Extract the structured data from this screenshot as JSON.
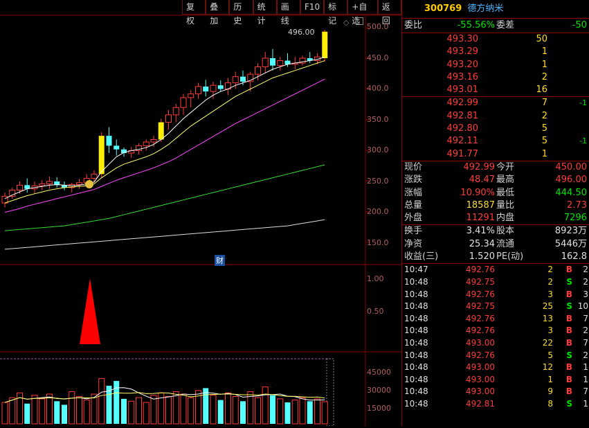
{
  "toolbar": [
    "复权",
    "叠加",
    "历史",
    "统计",
    "画线",
    "F10",
    "标记",
    "+自选",
    "返回"
  ],
  "stock": {
    "code": "300769",
    "name": "德方纳米"
  },
  "price_axis": [
    "500.0",
    "450.0",
    "400.0",
    "350.0",
    "300.0",
    "250.0",
    "200.0",
    "150.0"
  ],
  "hi_label": "496.00",
  "fin_label": "财",
  "ind_axis": [
    "1.00",
    "0.50"
  ],
  "vol_axis": [
    "45000",
    "30000",
    "15000"
  ],
  "weibi": {
    "label1": "委比",
    "value1": "-55.56%",
    "label2": "委差",
    "value2": "-50"
  },
  "sells": [
    {
      "label": "卖五",
      "price": "493.30",
      "vol": "50",
      "chg": ""
    },
    {
      "label": "卖四",
      "price": "493.29",
      "vol": "1",
      "chg": ""
    },
    {
      "label": "卖三",
      "price": "493.20",
      "vol": "1",
      "chg": ""
    },
    {
      "label": "卖二",
      "price": "493.16",
      "vol": "2",
      "chg": ""
    },
    {
      "label": "卖一",
      "price": "493.01",
      "vol": "16",
      "chg": ""
    }
  ],
  "buys": [
    {
      "label": "买一",
      "price": "492.99",
      "vol": "7",
      "chg": "-1"
    },
    {
      "label": "买二",
      "price": "492.81",
      "vol": "2",
      "chg": ""
    },
    {
      "label": "买三",
      "price": "492.80",
      "vol": "5",
      "chg": ""
    },
    {
      "label": "买四",
      "price": "492.11",
      "vol": "5",
      "chg": "-1"
    },
    {
      "label": "买五",
      "price": "491.77",
      "vol": "1",
      "chg": ""
    }
  ],
  "stats": [
    {
      "l1": "现价",
      "v1": "492.99",
      "l2": "今开",
      "v2": "450.00",
      "c1": "red",
      "c2": "red"
    },
    {
      "l1": "涨跌",
      "v1": "48.47",
      "l2": "最高",
      "v2": "496.00",
      "c1": "red",
      "c2": "red"
    },
    {
      "l1": "涨幅",
      "v1": "10.90%",
      "l2": "最低",
      "v2": "444.50",
      "c1": "red",
      "c2": "green"
    },
    {
      "l1": "总量",
      "v1": "18587",
      "l2": "量比",
      "v2": "2.73",
      "c1": "yellow",
      "c2": "red"
    },
    {
      "l1": "外盘",
      "v1": "11291",
      "l2": "内盘",
      "v2": "7296",
      "c1": "red",
      "c2": "green"
    }
  ],
  "stats2": [
    {
      "l1": "换手",
      "v1": "3.41%",
      "l2": "股本",
      "v2": "8923万"
    },
    {
      "l1": "净资",
      "v1": "25.34",
      "l2": "流通",
      "v2": "5446万"
    },
    {
      "l1": "收益(三)",
      "v1": "1.520",
      "l2": "PE(动)",
      "v2": "162.8"
    }
  ],
  "ticks": [
    {
      "t": "10:47",
      "p": "492.76",
      "v": "2",
      "bs": "B",
      "n": "2"
    },
    {
      "t": "10:48",
      "p": "492.75",
      "v": "2",
      "bs": "S",
      "n": "2"
    },
    {
      "t": "10:48",
      "p": "492.76",
      "v": "3",
      "bs": "B",
      "n": "3"
    },
    {
      "t": "10:48",
      "p": "492.75",
      "v": "25",
      "bs": "S",
      "n": "10"
    },
    {
      "t": "10:48",
      "p": "492.76",
      "v": "13",
      "bs": "B",
      "n": "7"
    },
    {
      "t": "10:48",
      "p": "492.76",
      "v": "3",
      "bs": "B",
      "n": "2"
    },
    {
      "t": "10:48",
      "p": "493.00",
      "v": "22",
      "bs": "B",
      "n": "7"
    },
    {
      "t": "10:48",
      "p": "492.76",
      "v": "5",
      "bs": "S",
      "n": "2"
    },
    {
      "t": "10:48",
      "p": "493.00",
      "v": "12",
      "bs": "B",
      "n": "1"
    },
    {
      "t": "10:48",
      "p": "493.00",
      "v": "1",
      "bs": "B",
      "n": "1"
    },
    {
      "t": "10:48",
      "p": "493.00",
      "v": "9",
      "bs": "B",
      "n": "7"
    },
    {
      "t": "10:48",
      "p": "492.81",
      "v": "8",
      "bs": "S",
      "n": "1"
    }
  ],
  "candles": [
    [
      215,
      232,
      208,
      226
    ],
    [
      226,
      240,
      222,
      236
    ],
    [
      236,
      250,
      230,
      244
    ],
    [
      244,
      255,
      232,
      238
    ],
    [
      238,
      250,
      230,
      243
    ],
    [
      243,
      252,
      236,
      246
    ],
    [
      246,
      258,
      238,
      250
    ],
    [
      250,
      257,
      240,
      244
    ],
    [
      244,
      250,
      236,
      240
    ],
    [
      240,
      248,
      232,
      245
    ],
    [
      245,
      254,
      238,
      248
    ],
    [
      248,
      262,
      244,
      255
    ],
    [
      255,
      268,
      248,
      262
    ],
    [
      262,
      330,
      255,
      324
    ],
    [
      324,
      338,
      296,
      308
    ],
    [
      308,
      318,
      292,
      302
    ],
    [
      302,
      305,
      290,
      296
    ],
    [
      296,
      306,
      288,
      300
    ],
    [
      300,
      312,
      294,
      308
    ],
    [
      308,
      318,
      300,
      314
    ],
    [
      314,
      324,
      306,
      318
    ],
    [
      318,
      352,
      314,
      346
    ],
    [
      346,
      366,
      334,
      358
    ],
    [
      358,
      376,
      346,
      370
    ],
    [
      370,
      392,
      358,
      386
    ],
    [
      386,
      398,
      370,
      392
    ],
    [
      392,
      410,
      384,
      404
    ],
    [
      404,
      415,
      388,
      396
    ],
    [
      396,
      412,
      384,
      406
    ],
    [
      406,
      414,
      396,
      400
    ],
    [
      400,
      418,
      390,
      410
    ],
    [
      410,
      428,
      400,
      420
    ],
    [
      420,
      430,
      406,
      412
    ],
    [
      412,
      428,
      396,
      424
    ],
    [
      424,
      442,
      414,
      436
    ],
    [
      436,
      460,
      426,
      450
    ],
    [
      450,
      465,
      430,
      438
    ],
    [
      438,
      452,
      430,
      446
    ],
    [
      446,
      458,
      436,
      440
    ],
    [
      440,
      452,
      432,
      442
    ],
    [
      442,
      454,
      438,
      450
    ],
    [
      450,
      460,
      442,
      446
    ],
    [
      446,
      458,
      440,
      452
    ],
    [
      450,
      496,
      444.5,
      492.99
    ]
  ],
  "ma": {
    "ma5": [
      222,
      228,
      233,
      238,
      240,
      242,
      244,
      245,
      244,
      243,
      244,
      246,
      249,
      266,
      278,
      290,
      297,
      300,
      302,
      305,
      310,
      318,
      328,
      340,
      352,
      362,
      372,
      382,
      390,
      396,
      400,
      406,
      410,
      414,
      420,
      426,
      432,
      436,
      440,
      442,
      444,
      446,
      448,
      452
    ],
    "ma10": [
      215,
      219,
      223,
      227,
      230,
      233,
      236,
      238,
      240,
      241,
      242,
      243,
      246,
      256,
      264,
      272,
      278,
      282,
      286,
      290,
      295,
      302,
      310,
      320,
      330,
      340,
      348,
      356,
      364,
      372,
      380,
      388,
      394,
      400,
      406,
      412,
      418,
      422,
      426,
      430,
      434,
      438,
      442,
      446
    ],
    "ma20": [
      200,
      203,
      206,
      210,
      213,
      216,
      219,
      222,
      225,
      228,
      231,
      234,
      237,
      242,
      247,
      252,
      256,
      260,
      264,
      268,
      272,
      277,
      282,
      288,
      295,
      302,
      309,
      316,
      323,
      330,
      337,
      344,
      350,
      356,
      362,
      368,
      374,
      380,
      386,
      392,
      398,
      404,
      410,
      416
    ],
    "ma60": [
      170,
      171,
      172,
      173,
      174,
      175,
      176,
      177,
      178,
      180,
      182,
      184,
      186,
      188,
      190,
      193,
      196,
      199,
      202,
      205,
      208,
      211,
      214,
      217,
      220,
      223,
      226,
      229,
      232,
      235,
      238,
      241,
      244,
      247,
      250,
      253,
      256,
      259,
      262,
      265,
      268,
      271,
      274,
      277
    ],
    "ma120": [
      140,
      141,
      142,
      143,
      144,
      145,
      146,
      147,
      148,
      149,
      150,
      151,
      152,
      153,
      154,
      155,
      156,
      157,
      158,
      159,
      160,
      161,
      162,
      163,
      164,
      165,
      166,
      167,
      168,
      169,
      170,
      171,
      172,
      173,
      174,
      175,
      176,
      177,
      178,
      180,
      182,
      184,
      186,
      188
    ]
  },
  "volumes": [
    18000,
    22000,
    26000,
    17000,
    24000,
    21000,
    25000,
    19000,
    16000,
    27000,
    23000,
    20000,
    25000,
    38000,
    32000,
    36000,
    21000,
    19000,
    22000,
    18000,
    24000,
    26000,
    23000,
    27000,
    25000,
    22000,
    28000,
    30000,
    24000,
    20000,
    26000,
    23000,
    19000,
    27000,
    22000,
    31000,
    24000,
    21000,
    18000,
    20000,
    22000,
    19000,
    21000,
    18587
  ]
}
